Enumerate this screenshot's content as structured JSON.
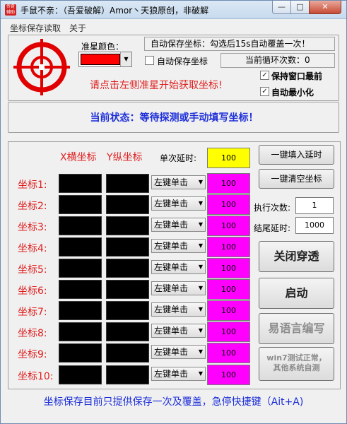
{
  "window": {
    "icon_text": "传奇 辅助",
    "title": "手鼠不亲：（吾爱破解）Amor丶天狼原创，非破解",
    "min_glyph": "—",
    "max_glyph": "□",
    "close_glyph": "✕"
  },
  "menu": [
    "坐标保存读取",
    "关于"
  ],
  "colors": {
    "accent_red": "#ff0000",
    "status_blue": "#1d2fd9",
    "yellow": "#ffff00",
    "magenta": "#ff00ff"
  },
  "top": {
    "crosshair_icon": "crosshair-icon",
    "star_color_label": "准星颜色：",
    "autosave_hint": "自动保存坐标：勾选后15s自动覆盖一次！",
    "autosave_label": "自动保存坐标",
    "loop_count_label": "当前循环次数：0",
    "keep_top_label": "保持窗口最前",
    "auto_minimize_label": "自动最小化",
    "hint": "请点击左侧准星开始获取坐标!"
  },
  "status": {
    "text": "当前状态：等待探测或手动填写坐标！"
  },
  "coords": {
    "x_header": "X横坐标",
    "y_header": "Y纵坐标",
    "single_delay_label": "单次延时:",
    "single_delay_value": "100",
    "rows": [
      {
        "label": "坐标1:",
        "action": "左键单击",
        "delay": "100"
      },
      {
        "label": "坐标2:",
        "action": "左键单击",
        "delay": "100"
      },
      {
        "label": "坐标3:",
        "action": "左键单击",
        "delay": "100"
      },
      {
        "label": "坐标4:",
        "action": "左键单击",
        "delay": "100"
      },
      {
        "label": "坐标5:",
        "action": "左键单击",
        "delay": "100"
      },
      {
        "label": "坐标6:",
        "action": "左键单击",
        "delay": "100"
      },
      {
        "label": "坐标7:",
        "action": "左键单击",
        "delay": "100"
      },
      {
        "label": "坐标8:",
        "action": "左键单击",
        "delay": "100"
      },
      {
        "label": "坐标9:",
        "action": "左键单击",
        "delay": "100"
      },
      {
        "label": "坐标10:",
        "action": "左键单击",
        "delay": "100"
      }
    ]
  },
  "side": {
    "fill_delay": "一键填入延时",
    "clear_coords": "一键清空坐标",
    "exec_count_label": "执行次数:",
    "exec_count_value": "1",
    "end_delay_label": "结尾延时:",
    "end_delay_value": "1000",
    "close_through": "关闭穿透",
    "start": "启动",
    "easy_lang": "易语言编写",
    "win7_line1": "win7测试正常，",
    "win7_line2": "其他系统自测"
  },
  "footer": {
    "text": "坐标保存目前只提供保存一次及覆盖，急停快捷键（Ait+A)"
  }
}
